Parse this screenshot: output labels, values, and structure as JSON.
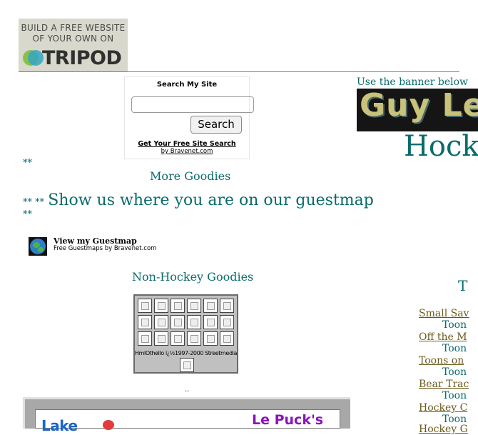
{
  "banner": {
    "line1": "BUILD A FREE WEBSITE",
    "line2": "OF YOUR OWN ON",
    "brand": "TRIPOD"
  },
  "search": {
    "title": "Search My Site",
    "input_value": "",
    "button": "Search",
    "link": "Get Your Free Site Search",
    "by": "by Bravenet.com"
  },
  "right_header": {
    "use_banner": "Use the banner below",
    "guy_banner_text": "Guy Le",
    "heading": "Hock"
  },
  "left": {
    "stars1": "**",
    "more_goodies": "More Goodies",
    "guestmap_stars": "** **",
    "guestmap_text": "Show us where you are on our guestmap",
    "stars3": "**",
    "guestmap_title": "View my Guestmap",
    "guestmap_sub": "Free Guestmaps by Bravenet.com",
    "nonhockey": "Non-Hockey Goodies",
    "grid_caption": "HmlOthello ï¿½1997-2000 Streetmedia",
    "dots": "..",
    "lake_text": "Lake",
    "lepuck": "Le Puck's"
  },
  "right_links": {
    "t_letter": "T",
    "items": [
      {
        "link": "Small Sav",
        "sub": "Toon"
      },
      {
        "link": "Off the M",
        "sub": "Toon"
      },
      {
        "link": "Toons on",
        "sub": "Toon"
      },
      {
        "link": "Bear Trac",
        "sub": "Toon"
      },
      {
        "link": "Hockey C",
        "sub": "Toon"
      },
      {
        "link": "Hockey G",
        "sub": ""
      }
    ]
  }
}
